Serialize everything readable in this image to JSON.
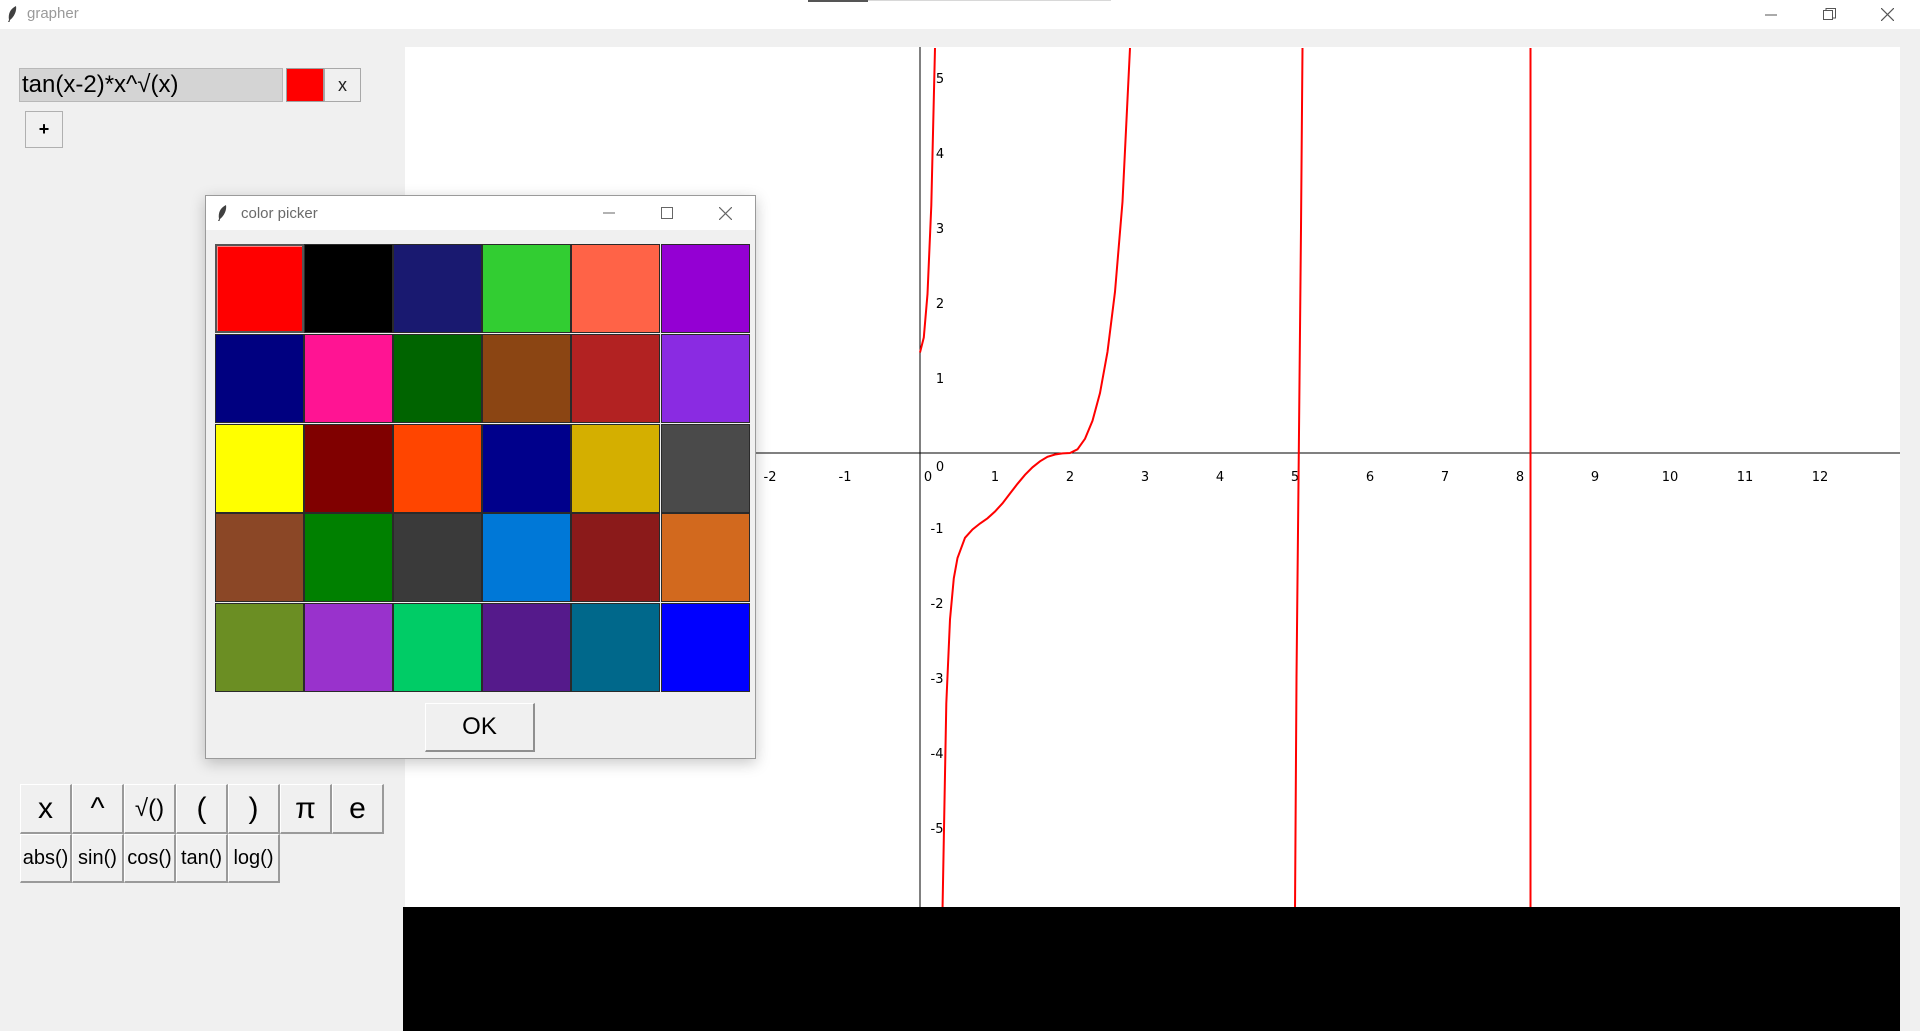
{
  "window": {
    "title": "grapher"
  },
  "expression": {
    "value": "tan(x-2)*x^√(x)",
    "color": "#ff0000",
    "remove_label": "x"
  },
  "add_label": "+",
  "keypad": {
    "row1": [
      "x",
      "^",
      "√()",
      "(",
      ")",
      "π",
      "e"
    ],
    "row2": [
      "abs()",
      "sin()",
      "cos()",
      "tan()",
      "log()"
    ]
  },
  "graph": {
    "x_ticks": [
      "-2",
      "-1",
      "0",
      "1",
      "2",
      "3",
      "4",
      "5",
      "6",
      "7",
      "8",
      "9",
      "10",
      "11",
      "12"
    ],
    "y_ticks": [
      "5",
      "4",
      "3",
      "2",
      "1",
      "0",
      "-1",
      "-2",
      "-3",
      "-4",
      "-5"
    ],
    "curve_color": "#ff0000"
  },
  "chart_data": {
    "type": "line",
    "title": "",
    "xlabel": "",
    "ylabel": "",
    "xlim": [
      -2.15,
      12.3
    ],
    "ylim": [
      -6.1,
      5.4
    ],
    "grid": false,
    "series": [
      {
        "x": [
          0,
          0.05,
          0.1,
          0.15,
          0.2,
          0.25,
          0.3,
          0.35,
          0.4,
          0.45,
          0.5,
          0.6,
          0.7,
          0.8,
          0.9,
          1.0,
          1.1,
          1.2,
          1.3,
          1.4,
          1.5,
          1.6,
          1.7,
          1.8,
          1.9,
          2.0,
          2.1,
          2.2,
          2.3,
          2.4,
          2.5,
          2.6,
          2.7,
          2.8
        ],
        "y": [
          1.34,
          1.54,
          2.12,
          3.3,
          5.4,
          null,
          -6.1,
          -3.34,
          -2.22,
          -1.67,
          -1.4,
          -1.13,
          -1.02,
          -0.94,
          -0.87,
          -0.78,
          -0.67,
          -0.54,
          -0.41,
          -0.29,
          -0.19,
          -0.11,
          -0.05,
          -0.02,
          -0.005,
          0,
          0.05,
          0.19,
          0.43,
          0.8,
          1.35,
          2.15,
          3.35,
          5.4
        ]
      },
      {
        "x": [
          5.0,
          5.02,
          5.05,
          5.08,
          5.1
        ],
        "y": [
          -6.1,
          -3.0,
          0,
          3.0,
          5.4
        ]
      },
      {
        "x": [
          8.14,
          8.14
        ],
        "y": [
          -6.1,
          5.4
        ]
      }
    ]
  },
  "dialog": {
    "title": "color picker",
    "ok_label": "OK",
    "selected": "#ff0000",
    "colors": [
      "#ff0000",
      "#000000",
      "#191970",
      "#32cd32",
      "#ff6347",
      "#9400d3",
      "#000080",
      "#ff1493",
      "#006400",
      "#8b4513",
      "#b22222",
      "#8a2be2",
      "#ffff00",
      "#800000",
      "#ff4500",
      "#00008b",
      "#d4af00",
      "#4a4a4a",
      "#8b4726",
      "#008000",
      "#3a3a3a",
      "#0078d7",
      "#8b1a1a",
      "#d2691e",
      "#6b8e23",
      "#9932cc",
      "#00cc66",
      "#551a8b",
      "#00688b",
      "#0000ff"
    ]
  }
}
